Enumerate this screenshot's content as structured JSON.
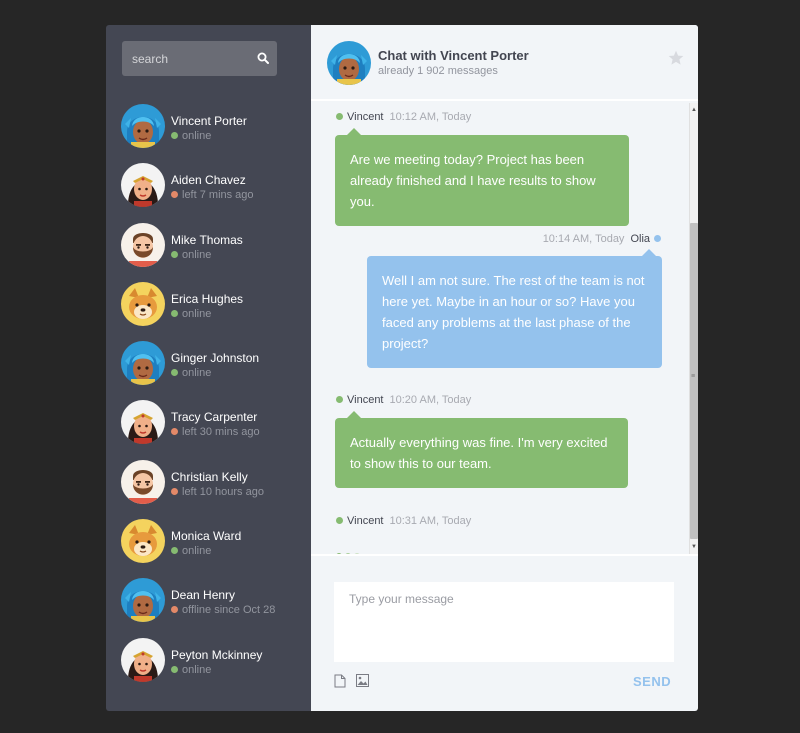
{
  "search": {
    "placeholder": "search"
  },
  "people": [
    {
      "name": "Vincent Porter",
      "status": "online",
      "state": "online",
      "avatar": "blue"
    },
    {
      "name": "Aiden Chavez",
      "status": "left 7 mins ago",
      "state": "away",
      "avatar": "wonder"
    },
    {
      "name": "Mike Thomas",
      "status": "online",
      "state": "online",
      "avatar": "beard"
    },
    {
      "name": "Erica Hughes",
      "status": "online",
      "state": "online",
      "avatar": "dog"
    },
    {
      "name": "Ginger Johnston",
      "status": "online",
      "state": "online",
      "avatar": "blue"
    },
    {
      "name": "Tracy Carpenter",
      "status": "left 30 mins ago",
      "state": "away",
      "avatar": "wonder"
    },
    {
      "name": "Christian Kelly",
      "status": "left 10 hours ago",
      "state": "away",
      "avatar": "beard"
    },
    {
      "name": "Monica Ward",
      "status": "online",
      "state": "online",
      "avatar": "dog"
    },
    {
      "name": "Dean Henry",
      "status": "offline since Oct 28",
      "state": "away",
      "avatar": "blue"
    },
    {
      "name": "Peyton Mckinney",
      "status": "online",
      "state": "online",
      "avatar": "wonder"
    }
  ],
  "chat": {
    "title": "Chat with Vincent Porter",
    "count": "already 1 902 messages"
  },
  "messages": [
    {
      "who": "Vincent",
      "time": "10:12 AM, Today",
      "text": "Are we meeting today? Project has been already finished and I have results to show you.",
      "side": "left"
    },
    {
      "who": "Olia",
      "time": "10:14 AM, Today",
      "text": "Well I am not sure. The rest of the team is not here yet. Maybe in an hour or so? Have you faced any problems at the last phase of the project?",
      "side": "right"
    },
    {
      "who": "Vincent",
      "time": "10:20 AM, Today",
      "text": "Actually everything was fine. I'm very excited to show this to our team.",
      "side": "left"
    },
    {
      "who": "Vincent",
      "time": "10:31 AM, Today",
      "text": "",
      "side": "left"
    }
  ],
  "composer": {
    "placeholder": "Type your message",
    "send_label": "SEND"
  },
  "colors": {
    "sidebar_bg": "#444753",
    "chat_bg": "#f2f5f8",
    "online": "#86bb71",
    "away": "#e38968",
    "me_bubble": "#86bb71",
    "other_bubble": "#94c2ed"
  },
  "icons": {
    "search": "search-icon",
    "star": "star-icon",
    "file": "file-icon",
    "image": "image-icon"
  }
}
